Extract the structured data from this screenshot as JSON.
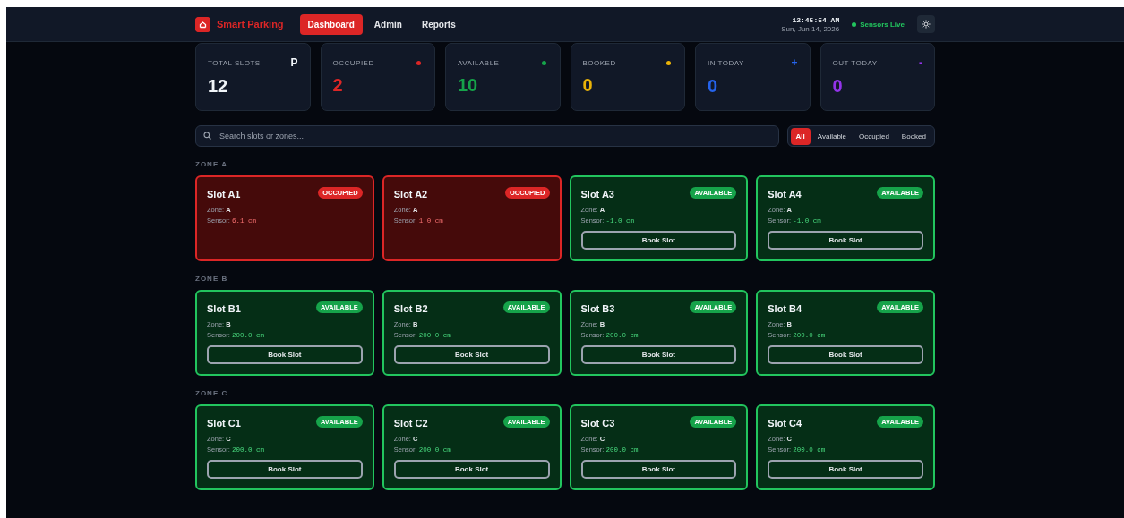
{
  "header": {
    "brand": "Smart Parking",
    "nav": [
      {
        "label": "Dashboard",
        "selected": true
      },
      {
        "label": "Admin",
        "selected": false
      },
      {
        "label": "Reports",
        "selected": false
      }
    ],
    "time": "12:45:54 AM",
    "date": "Sun, Jun 14, 2026",
    "live": {
      "label": "Sensors Live",
      "color": "#22c55e"
    }
  },
  "stats": [
    {
      "label": "TOTAL SLOTS",
      "value": "12",
      "kind": "glyph",
      "icon": "P",
      "color": "#f1f5f9"
    },
    {
      "label": "OCCUPIED",
      "value": "2",
      "kind": "dot",
      "color": "#dc2626"
    },
    {
      "label": "AVAILABLE",
      "value": "10",
      "kind": "dot",
      "color": "#16a34a"
    },
    {
      "label": "BOOKED",
      "value": "0",
      "kind": "dot",
      "color": "#eab308"
    },
    {
      "label": "IN TODAY",
      "value": "0",
      "kind": "glyph",
      "icon": "+",
      "color": "#2563eb"
    },
    {
      "label": "OUT TODAY",
      "value": "0",
      "kind": "glyph",
      "icon": "-",
      "color": "#9333ea"
    }
  ],
  "search": {
    "placeholder": "Search slots or zones..."
  },
  "filters": [
    {
      "label": "All",
      "selected": true
    },
    {
      "label": "Available",
      "selected": false
    },
    {
      "label": "Occupied",
      "selected": false
    },
    {
      "label": "Booked",
      "selected": false
    }
  ],
  "zones": [
    {
      "title": "ZONE A",
      "slots": [
        {
          "name": "Slot A1",
          "kind": "occupied",
          "badge": "OCCUPIED",
          "zone_label": "Zone:",
          "zone": "A",
          "sensor_label": "Sensor:",
          "sensor": "6.1 cm"
        },
        {
          "name": "Slot A2",
          "kind": "occupied",
          "badge": "OCCUPIED",
          "zone_label": "Zone:",
          "zone": "A",
          "sensor_label": "Sensor:",
          "sensor": "1.0 cm"
        },
        {
          "name": "Slot A3",
          "kind": "available",
          "badge": "AVAILABLE",
          "zone_label": "Zone:",
          "zone": "A",
          "sensor_label": "Sensor:",
          "sensor": "-1.0 cm",
          "button": "Book Slot"
        },
        {
          "name": "Slot A4",
          "kind": "available",
          "badge": "AVAILABLE",
          "zone_label": "Zone:",
          "zone": "A",
          "sensor_label": "Sensor:",
          "sensor": "-1.0 cm",
          "button": "Book Slot"
        }
      ]
    },
    {
      "title": "ZONE B",
      "slots": [
        {
          "name": "Slot B1",
          "kind": "available",
          "badge": "AVAILABLE",
          "zone_label": "Zone:",
          "zone": "B",
          "sensor_label": "Sensor:",
          "sensor": "200.0 cm",
          "button": "Book Slot"
        },
        {
          "name": "Slot B2",
          "kind": "available",
          "badge": "AVAILABLE",
          "zone_label": "Zone:",
          "zone": "B",
          "sensor_label": "Sensor:",
          "sensor": "200.0 cm",
          "button": "Book Slot"
        },
        {
          "name": "Slot B3",
          "kind": "available",
          "badge": "AVAILABLE",
          "zone_label": "Zone:",
          "zone": "B",
          "sensor_label": "Sensor:",
          "sensor": "200.0 cm",
          "button": "Book Slot"
        },
        {
          "name": "Slot B4",
          "kind": "available",
          "badge": "AVAILABLE",
          "zone_label": "Zone:",
          "zone": "B",
          "sensor_label": "Sensor:",
          "sensor": "200.0 cm",
          "button": "Book Slot"
        }
      ]
    },
    {
      "title": "ZONE C",
      "slots": [
        {
          "name": "Slot C1",
          "kind": "available",
          "badge": "AVAILABLE",
          "zone_label": "Zone:",
          "zone": "C",
          "sensor_label": "Sensor:",
          "sensor": "200.0 cm",
          "button": "Book Slot"
        },
        {
          "name": "Slot C2",
          "kind": "available",
          "badge": "AVAILABLE",
          "zone_label": "Zone:",
          "zone": "C",
          "sensor_label": "Sensor:",
          "sensor": "200.0 cm",
          "button": "Book Slot"
        },
        {
          "name": "Slot C3",
          "kind": "available",
          "badge": "AVAILABLE",
          "zone_label": "Zone:",
          "zone": "C",
          "sensor_label": "Sensor:",
          "sensor": "200.0 cm",
          "button": "Book Slot"
        },
        {
          "name": "Slot C4",
          "kind": "available",
          "badge": "AVAILABLE",
          "zone_label": "Zone:",
          "zone": "C",
          "sensor_label": "Sensor:",
          "sensor": "200.0 cm",
          "button": "Book Slot"
        }
      ]
    }
  ]
}
